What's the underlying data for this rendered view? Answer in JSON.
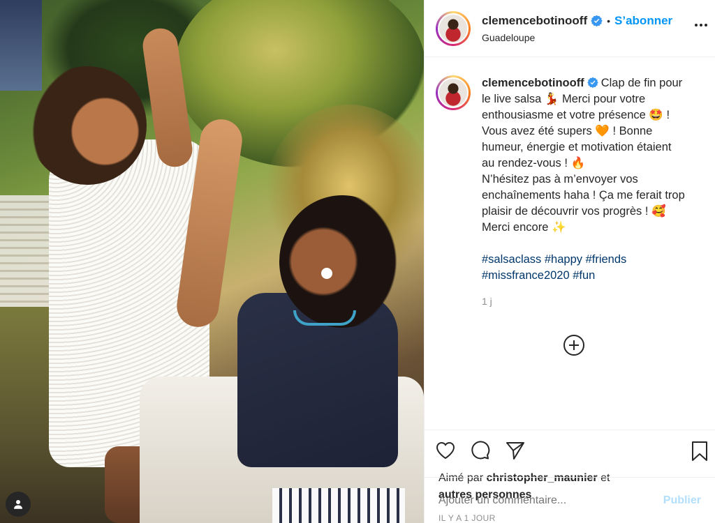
{
  "post": {
    "username": "clemencebotinooff",
    "follow_label": "S’abonner",
    "dot": "•",
    "location": "Guadeloupe",
    "caption_lines": [
      "Clap de fin pour",
      "le live salsa 💃  Merci pour votre",
      "enthousiasme et votre présence 🤩 !",
      "Vous avez été supers 🧡  ! Bonne",
      "humeur, énergie et motivation étaient",
      "au rendez-vous ! 🔥",
      "N’hésitez pas à m’envoyer vos",
      "enchaînements haha ! Ça me ferait trop",
      "plaisir de découvrir vos progrès ! 🥰",
      "Merci encore ✨"
    ],
    "hashtags_line1": "#salsaclass #happy #friends",
    "hashtags_line2": "#missfrance2020 #fun",
    "caption_time": "1 j",
    "likes_prefix": "Aimé par",
    "likes_user": "christopher_maunier",
    "likes_and": "et",
    "likes_others": "autres personnes",
    "date": "IL Y A 1 JOUR",
    "comment_placeholder": "Ajouter un commentaire...",
    "publish_label": "Publier"
  },
  "colors": {
    "accent": "#0095f6",
    "hashtag": "#00376b",
    "muted": "#8e8e8e",
    "publish_disabled": "#b2dffc"
  },
  "icons": [
    "verified-badge-icon",
    "more-options-icon",
    "add-circle-icon",
    "heart-icon",
    "comment-icon",
    "share-icon",
    "bookmark-icon",
    "user-tag-icon"
  ]
}
